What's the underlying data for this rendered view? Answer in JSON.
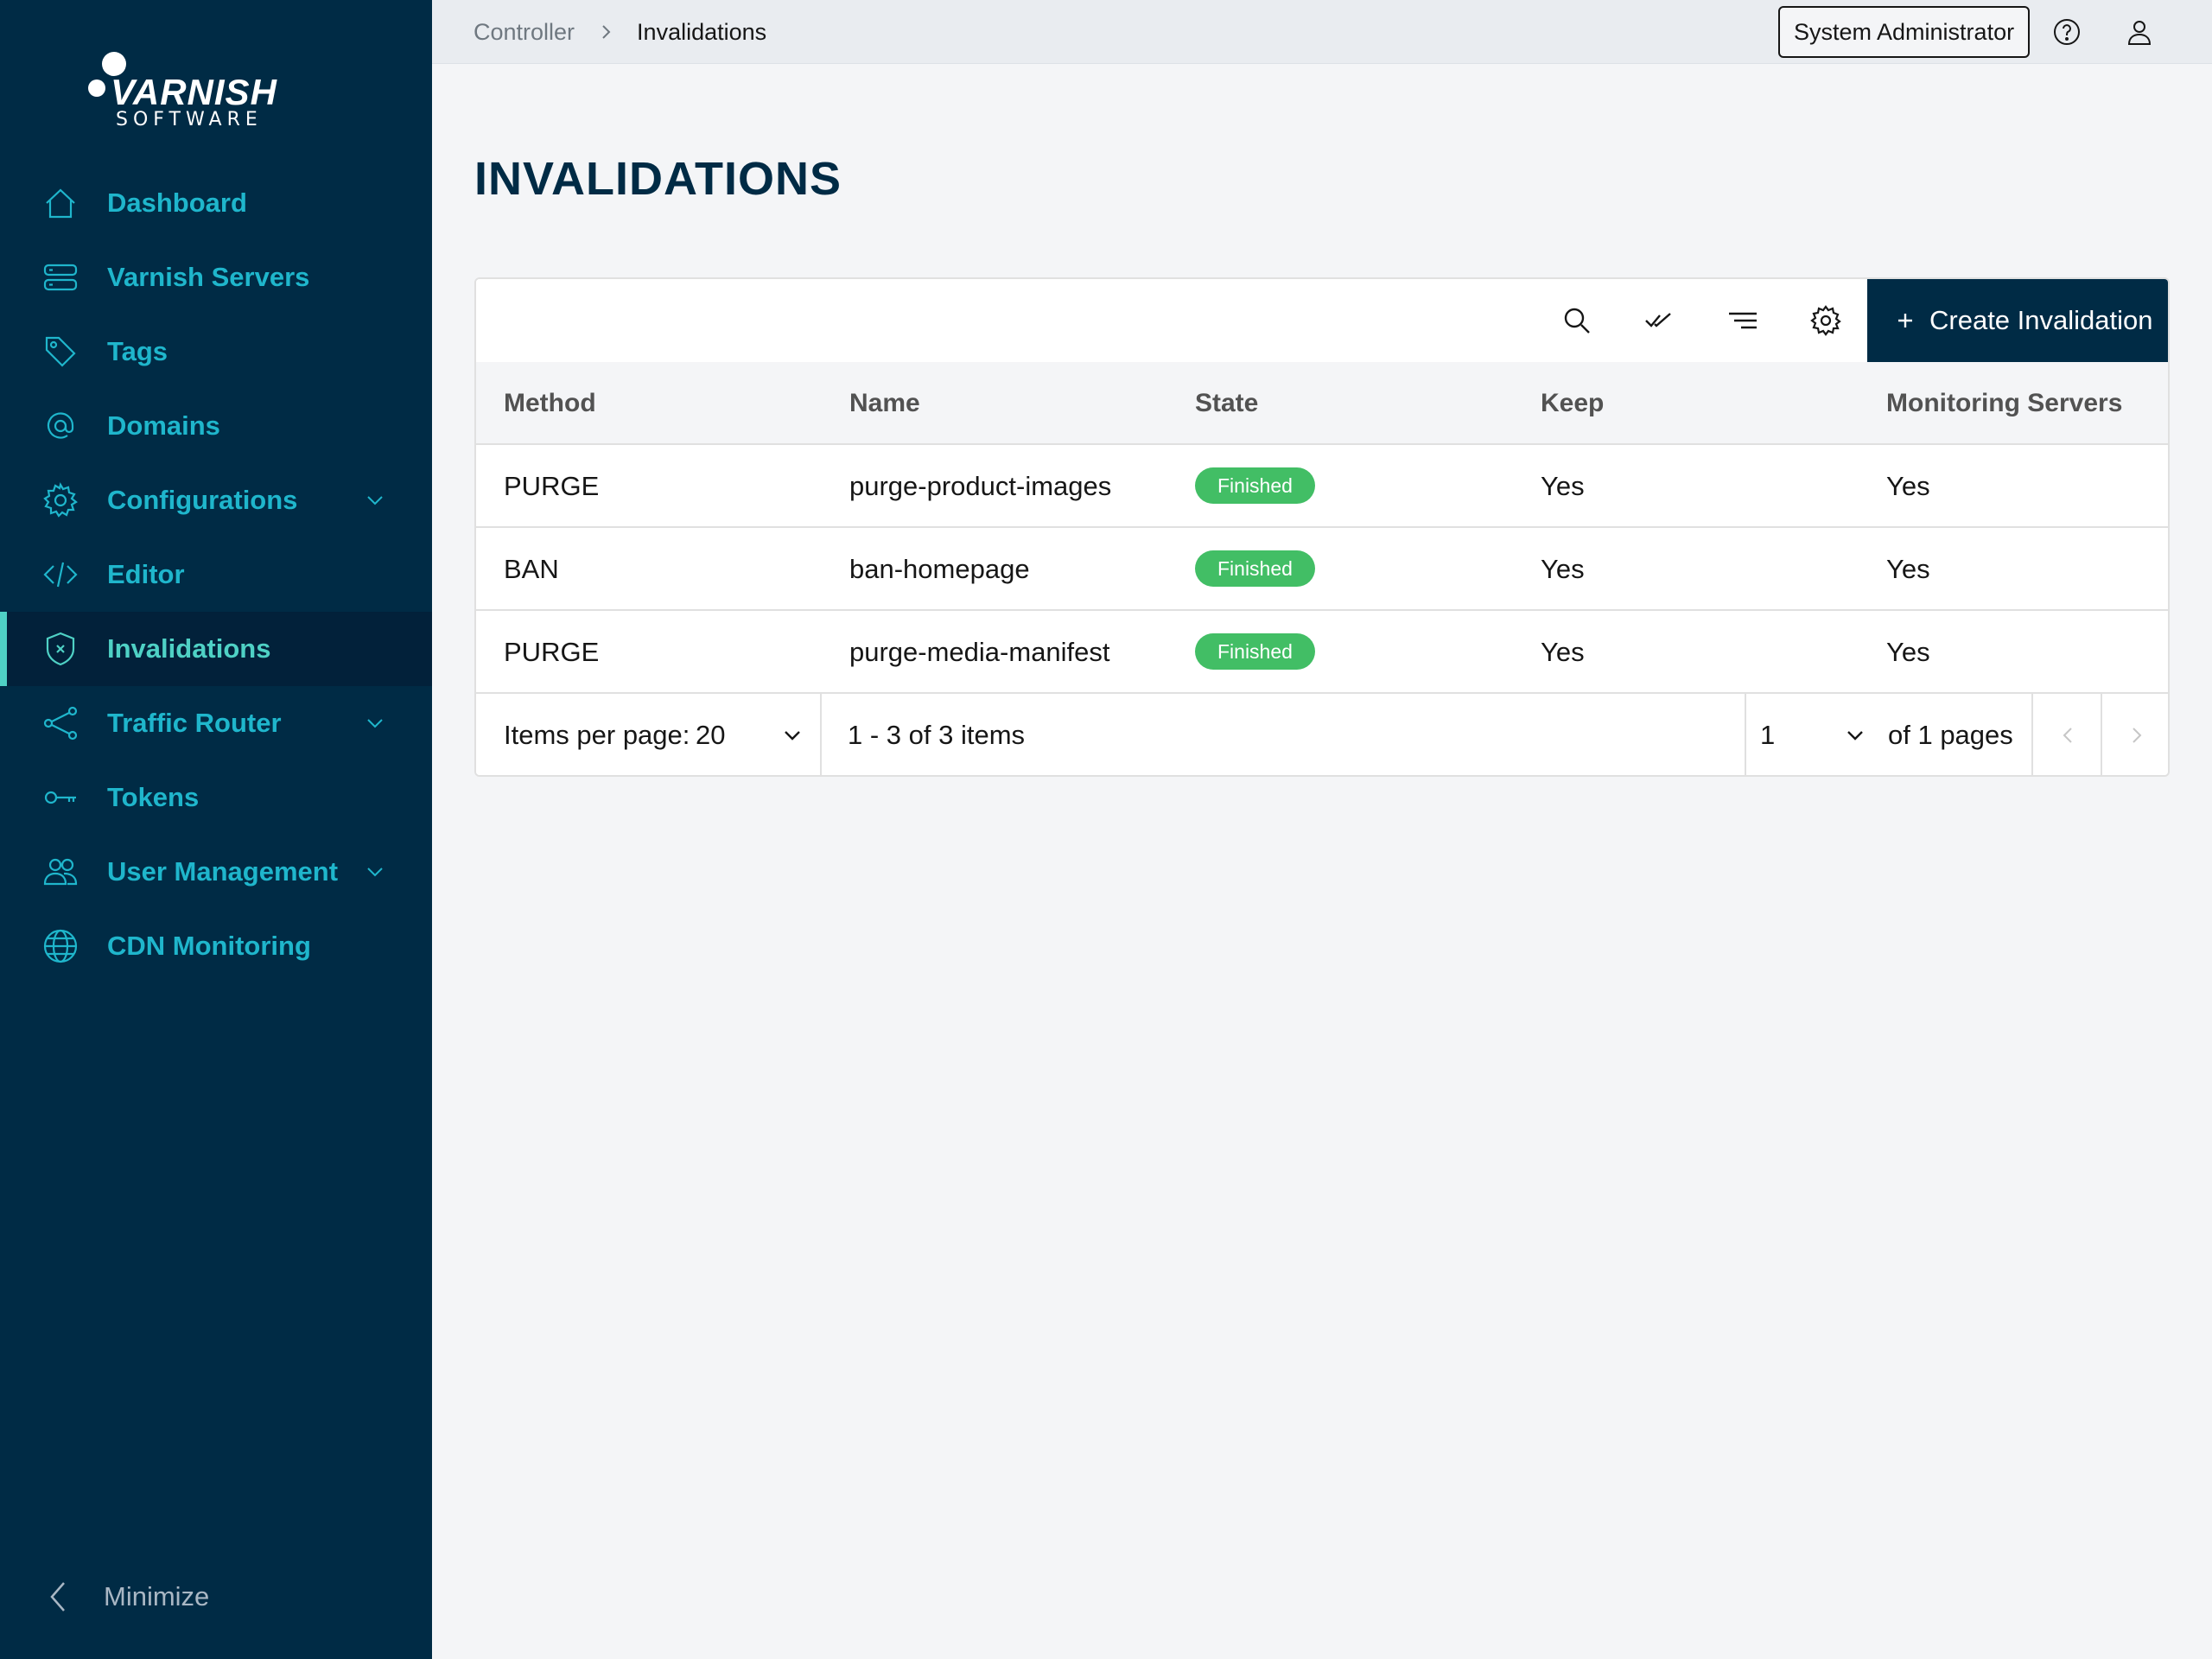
{
  "brand": {
    "name": "VARNISH",
    "sub": "SOFTWARE"
  },
  "sidebar": {
    "items": [
      {
        "label": "Dashboard",
        "icon": "home-icon",
        "expandable": false,
        "active": false
      },
      {
        "label": "Varnish Servers",
        "icon": "server-icon",
        "expandable": false,
        "active": false
      },
      {
        "label": "Tags",
        "icon": "tag-icon",
        "expandable": false,
        "active": false
      },
      {
        "label": "Domains",
        "icon": "at-icon",
        "expandable": false,
        "active": false
      },
      {
        "label": "Configurations",
        "icon": "gear-icon",
        "expandable": true,
        "active": false
      },
      {
        "label": "Editor",
        "icon": "code-icon",
        "expandable": false,
        "active": false
      },
      {
        "label": "Invalidations",
        "icon": "shield-x-icon",
        "expandable": false,
        "active": true
      },
      {
        "label": "Traffic Router",
        "icon": "share-icon",
        "expandable": true,
        "active": false
      },
      {
        "label": "Tokens",
        "icon": "key-icon",
        "expandable": false,
        "active": false
      },
      {
        "label": "User Management",
        "icon": "users-icon",
        "expandable": true,
        "active": false
      },
      {
        "label": "CDN Monitoring",
        "icon": "globe-icon",
        "expandable": false,
        "active": false
      }
    ],
    "minimize_label": "Minimize"
  },
  "header": {
    "breadcrumb": {
      "root": "Controller",
      "current": "Invalidations"
    },
    "user_role": "System Administrator"
  },
  "main": {
    "title": "INVALIDATIONS",
    "create_label": "Create Invalidation",
    "columns": [
      "Method",
      "Name",
      "State",
      "Keep",
      "Monitoring Servers"
    ],
    "rows": [
      {
        "method": "PURGE",
        "name": "purge-product-images",
        "state": "Finished",
        "keep": "Yes",
        "monitoring": "Yes"
      },
      {
        "method": "BAN",
        "name": "ban-homepage",
        "state": "Finished",
        "keep": "Yes",
        "monitoring": "Yes"
      },
      {
        "method": "PURGE",
        "name": "purge-media-manifest",
        "state": "Finished",
        "keep": "Yes",
        "monitoring": "Yes"
      }
    ],
    "pagination": {
      "items_per_page_label": "Items per page:",
      "items_per_page": "20",
      "range": "1 - 3 of 3 items",
      "page": "1",
      "of_pages": "of 1 pages"
    }
  },
  "colors": {
    "sidebar_bg": "#002b45",
    "nav_text": "#1fb6cc",
    "active_accent": "#4fd1c5",
    "badge_finished": "#42be65",
    "primary_button": "#002b45"
  }
}
